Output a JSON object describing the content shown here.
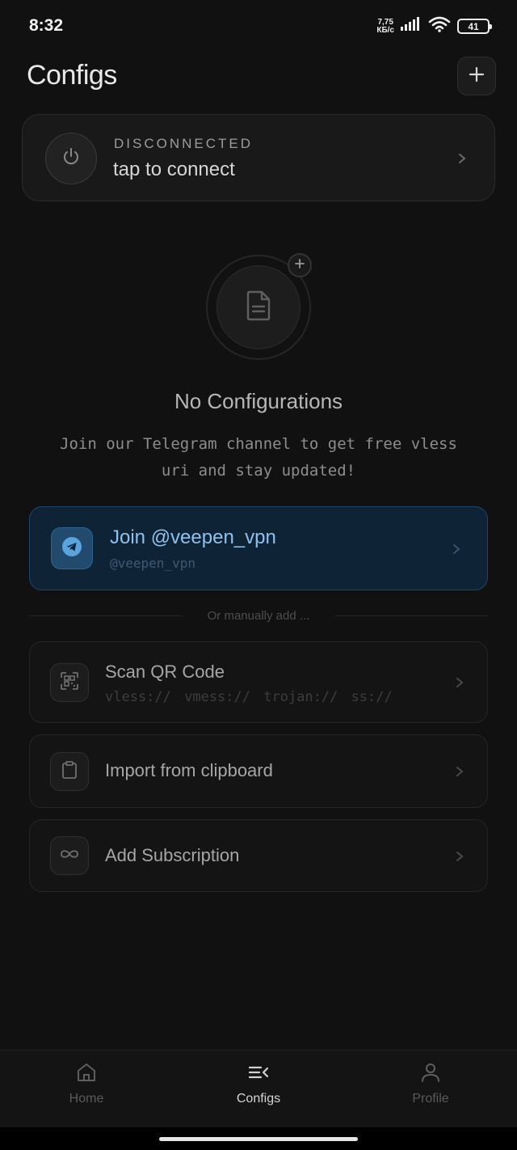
{
  "status_bar": {
    "time": "8:32",
    "net_speed_value": "7,75",
    "net_speed_unit": "КБ/с",
    "battery": "41"
  },
  "header": {
    "title": "Configs",
    "add_icon": "plus-icon"
  },
  "connection": {
    "status": "DISCONNECTED",
    "action": "tap to connect",
    "icon": "power-icon"
  },
  "empty_state": {
    "title": "No Configurations",
    "description_line1": "Join our Telegram channel to get free vless",
    "description_line2": "uri and stay updated!",
    "icon": "document-icon"
  },
  "telegram": {
    "title": "Join @veepen_vpn",
    "subtitle": "@veepen_vpn",
    "icon": "telegram-icon"
  },
  "divider_text": "Or manually add ...",
  "options": [
    {
      "title": "Scan QR Code",
      "subtitle": "vless:// vmess:// trojan:// ss://",
      "icon": "qr-code-icon"
    },
    {
      "title": "Import from clipboard",
      "icon": "clipboard-icon"
    },
    {
      "title": "Add Subscription",
      "icon": "infinity-icon"
    }
  ],
  "bottom_nav": {
    "items": [
      {
        "label": "Home",
        "icon": "home-icon",
        "active": false
      },
      {
        "label": "Configs",
        "icon": "configs-list-icon",
        "active": true
      },
      {
        "label": "Profile",
        "icon": "profile-icon",
        "active": false
      }
    ]
  },
  "colors": {
    "background": "#111111",
    "accent_blue": "#8fc1ec",
    "telegram_card_bg": "#0f2337"
  }
}
